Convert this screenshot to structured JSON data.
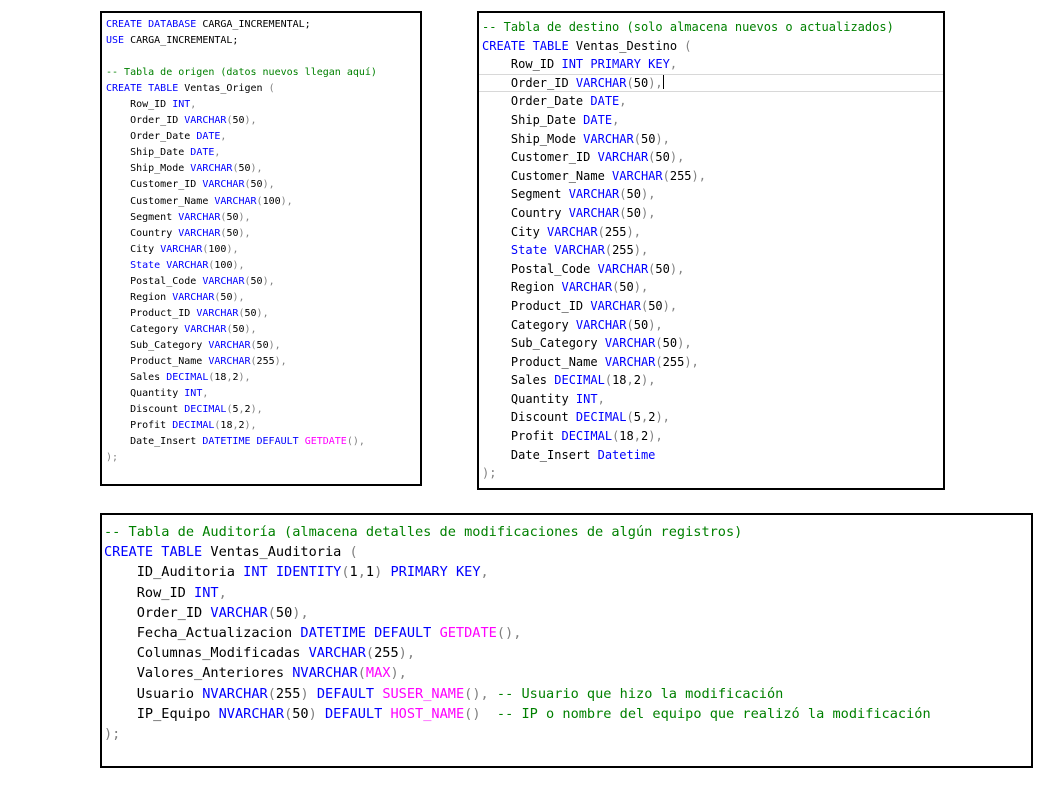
{
  "panel_origen": {
    "lines": [
      [
        [
          "kw",
          "CREATE DATABASE"
        ],
        [
          "tx",
          " CARGA_INCREMENTAL;"
        ]
      ],
      [
        [
          "kw",
          "USE"
        ],
        [
          "tx",
          " CARGA_INCREMENTAL;"
        ]
      ],
      [
        [
          "tx",
          ""
        ]
      ],
      [
        [
          "cm",
          "-- Tabla de origen (datos nuevos llegan aquí)"
        ]
      ],
      [
        [
          "kw",
          "CREATE TABLE"
        ],
        [
          "tx",
          " Ventas_Origen "
        ],
        [
          "gr",
          "("
        ]
      ],
      [
        [
          "tx",
          "    Row_ID "
        ],
        [
          "kw",
          "INT"
        ],
        [
          "gr",
          ","
        ]
      ],
      [
        [
          "tx",
          "    Order_ID "
        ],
        [
          "kw",
          "VARCHAR"
        ],
        [
          "gr",
          "("
        ],
        [
          "tx",
          "50"
        ],
        [
          "gr",
          "),"
        ]
      ],
      [
        [
          "tx",
          "    Order_Date "
        ],
        [
          "kw",
          "DATE"
        ],
        [
          "gr",
          ","
        ]
      ],
      [
        [
          "tx",
          "    Ship_Date "
        ],
        [
          "kw",
          "DATE"
        ],
        [
          "gr",
          ","
        ]
      ],
      [
        [
          "tx",
          "    Ship_Mode "
        ],
        [
          "kw",
          "VARCHAR"
        ],
        [
          "gr",
          "("
        ],
        [
          "tx",
          "50"
        ],
        [
          "gr",
          "),"
        ]
      ],
      [
        [
          "tx",
          "    Customer_ID "
        ],
        [
          "kw",
          "VARCHAR"
        ],
        [
          "gr",
          "("
        ],
        [
          "tx",
          "50"
        ],
        [
          "gr",
          "),"
        ]
      ],
      [
        [
          "tx",
          "    Customer_Name "
        ],
        [
          "kw",
          "VARCHAR"
        ],
        [
          "gr",
          "("
        ],
        [
          "tx",
          "100"
        ],
        [
          "gr",
          "),"
        ]
      ],
      [
        [
          "tx",
          "    Segment "
        ],
        [
          "kw",
          "VARCHAR"
        ],
        [
          "gr",
          "("
        ],
        [
          "tx",
          "50"
        ],
        [
          "gr",
          "),"
        ]
      ],
      [
        [
          "tx",
          "    Country "
        ],
        [
          "kw",
          "VARCHAR"
        ],
        [
          "gr",
          "("
        ],
        [
          "tx",
          "50"
        ],
        [
          "gr",
          "),"
        ]
      ],
      [
        [
          "tx",
          "    City "
        ],
        [
          "kw",
          "VARCHAR"
        ],
        [
          "gr",
          "("
        ],
        [
          "tx",
          "100"
        ],
        [
          "gr",
          "),"
        ]
      ],
      [
        [
          "kw",
          "    State"
        ],
        [
          "tx",
          " "
        ],
        [
          "kw",
          "VARCHAR"
        ],
        [
          "gr",
          "("
        ],
        [
          "tx",
          "100"
        ],
        [
          "gr",
          "),"
        ]
      ],
      [
        [
          "tx",
          "    Postal_Code "
        ],
        [
          "kw",
          "VARCHAR"
        ],
        [
          "gr",
          "("
        ],
        [
          "tx",
          "50"
        ],
        [
          "gr",
          "),"
        ]
      ],
      [
        [
          "tx",
          "    Region "
        ],
        [
          "kw",
          "VARCHAR"
        ],
        [
          "gr",
          "("
        ],
        [
          "tx",
          "50"
        ],
        [
          "gr",
          "),"
        ]
      ],
      [
        [
          "tx",
          "    Product_ID "
        ],
        [
          "kw",
          "VARCHAR"
        ],
        [
          "gr",
          "("
        ],
        [
          "tx",
          "50"
        ],
        [
          "gr",
          "),"
        ]
      ],
      [
        [
          "tx",
          "    Category "
        ],
        [
          "kw",
          "VARCHAR"
        ],
        [
          "gr",
          "("
        ],
        [
          "tx",
          "50"
        ],
        [
          "gr",
          "),"
        ]
      ],
      [
        [
          "tx",
          "    Sub_Category "
        ],
        [
          "kw",
          "VARCHAR"
        ],
        [
          "gr",
          "("
        ],
        [
          "tx",
          "50"
        ],
        [
          "gr",
          "),"
        ]
      ],
      [
        [
          "tx",
          "    Product_Name "
        ],
        [
          "kw",
          "VARCHAR"
        ],
        [
          "gr",
          "("
        ],
        [
          "tx",
          "255"
        ],
        [
          "gr",
          "),"
        ]
      ],
      [
        [
          "tx",
          "    Sales "
        ],
        [
          "kw",
          "DECIMAL"
        ],
        [
          "gr",
          "("
        ],
        [
          "tx",
          "18"
        ],
        [
          "gr",
          ","
        ],
        [
          "tx",
          "2"
        ],
        [
          "gr",
          "),"
        ]
      ],
      [
        [
          "tx",
          "    Quantity "
        ],
        [
          "kw",
          "INT"
        ],
        [
          "gr",
          ","
        ]
      ],
      [
        [
          "tx",
          "    Discount "
        ],
        [
          "kw",
          "DECIMAL"
        ],
        [
          "gr",
          "("
        ],
        [
          "tx",
          "5"
        ],
        [
          "gr",
          ","
        ],
        [
          "tx",
          "2"
        ],
        [
          "gr",
          "),"
        ]
      ],
      [
        [
          "tx",
          "    Profit "
        ],
        [
          "kw",
          "DECIMAL"
        ],
        [
          "gr",
          "("
        ],
        [
          "tx",
          "18"
        ],
        [
          "gr",
          ","
        ],
        [
          "tx",
          "2"
        ],
        [
          "gr",
          "),"
        ]
      ],
      [
        [
          "tx",
          "    Date_Insert "
        ],
        [
          "kw",
          "DATETIME DEFAULT"
        ],
        [
          "tx",
          " "
        ],
        [
          "fn",
          "GETDATE"
        ],
        [
          "gr",
          "(),"
        ]
      ],
      [
        [
          "gr",
          ");"
        ]
      ]
    ]
  },
  "panel_destino": {
    "lines": [
      [
        [
          "cm",
          "-- Tabla de destino (solo almacena nuevos o actualizados)"
        ]
      ],
      [
        [
          "kw",
          "CREATE TABLE"
        ],
        [
          "tx",
          " Ventas_Destino "
        ],
        [
          "gr",
          "("
        ]
      ],
      [
        [
          "tx",
          "    Row_ID "
        ],
        [
          "kw",
          "INT PRIMARY KEY"
        ],
        [
          "gr",
          ","
        ]
      ],
      [
        [
          "tx",
          "    Order_ID "
        ],
        [
          "kw",
          "VARCHAR"
        ],
        [
          "gr",
          "("
        ],
        [
          "tx",
          "50"
        ],
        [
          "gr",
          "),"
        ]
      ],
      [
        [
          "tx",
          "    Order_Date "
        ],
        [
          "kw",
          "DATE"
        ],
        [
          "gr",
          ","
        ]
      ],
      [
        [
          "tx",
          "    Ship_Date "
        ],
        [
          "kw",
          "DATE"
        ],
        [
          "gr",
          ","
        ]
      ],
      [
        [
          "tx",
          "    Ship_Mode "
        ],
        [
          "kw",
          "VARCHAR"
        ],
        [
          "gr",
          "("
        ],
        [
          "tx",
          "50"
        ],
        [
          "gr",
          "),"
        ]
      ],
      [
        [
          "tx",
          "    Customer_ID "
        ],
        [
          "kw",
          "VARCHAR"
        ],
        [
          "gr",
          "("
        ],
        [
          "tx",
          "50"
        ],
        [
          "gr",
          "),"
        ]
      ],
      [
        [
          "tx",
          "    Customer_Name "
        ],
        [
          "kw",
          "VARCHAR"
        ],
        [
          "gr",
          "("
        ],
        [
          "tx",
          "255"
        ],
        [
          "gr",
          "),"
        ]
      ],
      [
        [
          "tx",
          "    Segment "
        ],
        [
          "kw",
          "VARCHAR"
        ],
        [
          "gr",
          "("
        ],
        [
          "tx",
          "50"
        ],
        [
          "gr",
          "),"
        ]
      ],
      [
        [
          "tx",
          "    Country "
        ],
        [
          "kw",
          "VARCHAR"
        ],
        [
          "gr",
          "("
        ],
        [
          "tx",
          "50"
        ],
        [
          "gr",
          "),"
        ]
      ],
      [
        [
          "tx",
          "    City "
        ],
        [
          "kw",
          "VARCHAR"
        ],
        [
          "gr",
          "("
        ],
        [
          "tx",
          "255"
        ],
        [
          "gr",
          "),"
        ]
      ],
      [
        [
          "kw",
          "    State"
        ],
        [
          "tx",
          " "
        ],
        [
          "kw",
          "VARCHAR"
        ],
        [
          "gr",
          "("
        ],
        [
          "tx",
          "255"
        ],
        [
          "gr",
          "),"
        ]
      ],
      [
        [
          "tx",
          "    Postal_Code "
        ],
        [
          "kw",
          "VARCHAR"
        ],
        [
          "gr",
          "("
        ],
        [
          "tx",
          "50"
        ],
        [
          "gr",
          "),"
        ]
      ],
      [
        [
          "tx",
          "    Region "
        ],
        [
          "kw",
          "VARCHAR"
        ],
        [
          "gr",
          "("
        ],
        [
          "tx",
          "50"
        ],
        [
          "gr",
          "),"
        ]
      ],
      [
        [
          "tx",
          "    Product_ID "
        ],
        [
          "kw",
          "VARCHAR"
        ],
        [
          "gr",
          "("
        ],
        [
          "tx",
          "50"
        ],
        [
          "gr",
          "),"
        ]
      ],
      [
        [
          "tx",
          "    Category "
        ],
        [
          "kw",
          "VARCHAR"
        ],
        [
          "gr",
          "("
        ],
        [
          "tx",
          "50"
        ],
        [
          "gr",
          "),"
        ]
      ],
      [
        [
          "tx",
          "    Sub_Category "
        ],
        [
          "kw",
          "VARCHAR"
        ],
        [
          "gr",
          "("
        ],
        [
          "tx",
          "50"
        ],
        [
          "gr",
          "),"
        ]
      ],
      [
        [
          "tx",
          "    Product_Name "
        ],
        [
          "kw",
          "VARCHAR"
        ],
        [
          "gr",
          "("
        ],
        [
          "tx",
          "255"
        ],
        [
          "gr",
          "),"
        ]
      ],
      [
        [
          "tx",
          "    Sales "
        ],
        [
          "kw",
          "DECIMAL"
        ],
        [
          "gr",
          "("
        ],
        [
          "tx",
          "18"
        ],
        [
          "gr",
          ","
        ],
        [
          "tx",
          "2"
        ],
        [
          "gr",
          "),"
        ]
      ],
      [
        [
          "tx",
          "    Quantity "
        ],
        [
          "kw",
          "INT"
        ],
        [
          "gr",
          ","
        ]
      ],
      [
        [
          "tx",
          "    Discount "
        ],
        [
          "kw",
          "DECIMAL"
        ],
        [
          "gr",
          "("
        ],
        [
          "tx",
          "5"
        ],
        [
          "gr",
          ","
        ],
        [
          "tx",
          "2"
        ],
        [
          "gr",
          "),"
        ]
      ],
      [
        [
          "tx",
          "    Profit "
        ],
        [
          "kw",
          "DECIMAL"
        ],
        [
          "gr",
          "("
        ],
        [
          "tx",
          "18"
        ],
        [
          "gr",
          ","
        ],
        [
          "tx",
          "2"
        ],
        [
          "gr",
          "),"
        ]
      ],
      [
        [
          "tx",
          "    Date_Insert "
        ],
        [
          "kw",
          "Datetime"
        ]
      ],
      [
        [
          "gr",
          ");"
        ]
      ]
    ],
    "cursor_line": 3
  },
  "panel_auditoria": {
    "lines": [
      [
        [
          "cm",
          "-- Tabla de Auditoría (almacena detalles de modificaciones de algún registros)"
        ]
      ],
      [
        [
          "kw",
          "CREATE TABLE"
        ],
        [
          "tx",
          " Ventas_Auditoria "
        ],
        [
          "gr",
          "("
        ]
      ],
      [
        [
          "tx",
          "    ID_Auditoria "
        ],
        [
          "kw",
          "INT IDENTITY"
        ],
        [
          "gr",
          "("
        ],
        [
          "tx",
          "1"
        ],
        [
          "gr",
          ","
        ],
        [
          "tx",
          "1"
        ],
        [
          "gr",
          ")"
        ],
        [
          "tx",
          " "
        ],
        [
          "kw",
          "PRIMARY KEY"
        ],
        [
          "gr",
          ","
        ]
      ],
      [
        [
          "tx",
          "    Row_ID "
        ],
        [
          "kw",
          "INT"
        ],
        [
          "gr",
          ","
        ]
      ],
      [
        [
          "tx",
          "    Order_ID "
        ],
        [
          "kw",
          "VARCHAR"
        ],
        [
          "gr",
          "("
        ],
        [
          "tx",
          "50"
        ],
        [
          "gr",
          "),"
        ]
      ],
      [
        [
          "tx",
          "    Fecha_Actualizacion "
        ],
        [
          "kw",
          "DATETIME DEFAULT"
        ],
        [
          "tx",
          " "
        ],
        [
          "fn",
          "GETDATE"
        ],
        [
          "gr",
          "(),"
        ]
      ],
      [
        [
          "tx",
          "    Columnas_Modificadas "
        ],
        [
          "kw",
          "VARCHAR"
        ],
        [
          "gr",
          "("
        ],
        [
          "tx",
          "255"
        ],
        [
          "gr",
          "),"
        ]
      ],
      [
        [
          "tx",
          "    Valores_Anteriores "
        ],
        [
          "kw",
          "NVARCHAR"
        ],
        [
          "gr",
          "("
        ],
        [
          "fn",
          "MAX"
        ],
        [
          "gr",
          "),"
        ]
      ],
      [
        [
          "tx",
          "    Usuario "
        ],
        [
          "kw",
          "NVARCHAR"
        ],
        [
          "gr",
          "("
        ],
        [
          "tx",
          "255"
        ],
        [
          "gr",
          ")"
        ],
        [
          "tx",
          " "
        ],
        [
          "kw",
          "DEFAULT"
        ],
        [
          "tx",
          " "
        ],
        [
          "fn",
          "SUSER_NAME"
        ],
        [
          "gr",
          "(),"
        ],
        [
          "tx",
          " "
        ],
        [
          "cm",
          "-- Usuario que hizo la modificación"
        ]
      ],
      [
        [
          "tx",
          "    IP_Equipo "
        ],
        [
          "kw",
          "NVARCHAR"
        ],
        [
          "gr",
          "("
        ],
        [
          "tx",
          "50"
        ],
        [
          "gr",
          ")"
        ],
        [
          "tx",
          " "
        ],
        [
          "kw",
          "DEFAULT"
        ],
        [
          "tx",
          " "
        ],
        [
          "fn",
          "HOST_NAME"
        ],
        [
          "gr",
          "()"
        ],
        [
          "tx",
          "  "
        ],
        [
          "cm",
          "-- IP o nombre del equipo que realizó la modificación"
        ]
      ],
      [
        [
          "gr",
          ");"
        ]
      ]
    ]
  }
}
